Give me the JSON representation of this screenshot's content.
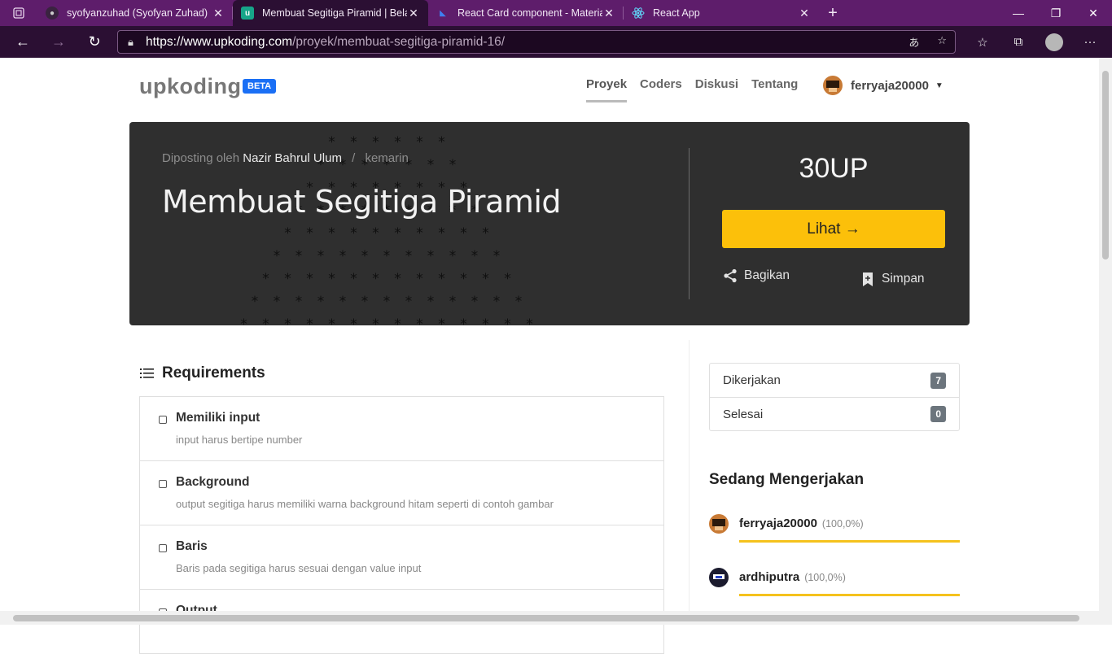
{
  "browser": {
    "tabs": [
      {
        "title": "syofyanzuhad (Syofyan Zuhad)",
        "favicon": "github-icon",
        "active": false
      },
      {
        "title": "Membuat Segitiga Piramid | Belajar",
        "favicon": "upkoding-icon",
        "active": true
      },
      {
        "title": "React Card component - Material",
        "favicon": "mui-icon",
        "active": false
      },
      {
        "title": "React App",
        "favicon": "react-icon",
        "active": false
      }
    ],
    "url_host": "https://www.upkoding.com",
    "url_path": "/proyek/membuat-segitiga-piramid-16/"
  },
  "site": {
    "logo": "upkoding",
    "beta": "BETA",
    "nav": [
      "Proyek",
      "Coders",
      "Diskusi",
      "Tentang"
    ],
    "username": "ferryaja20000"
  },
  "hero": {
    "posted_prefix": "Diposting oleh",
    "author": "Nazir Bahrul Ulum",
    "separator": "/",
    "time": "kemarin",
    "title": "Membuat Segitiga Piramid",
    "points": "30UP",
    "view_button": "Lihat →",
    "share": "Bagikan",
    "save": "Simpan",
    "background_colors": {
      "hero": "#2f2f2f",
      "button": "#fcc00a"
    }
  },
  "requirements": {
    "title": "Requirements",
    "items": [
      {
        "name": "Memiliki input",
        "desc": "input harus bertipe number"
      },
      {
        "name": "Background",
        "desc": "output segitiga harus memiliki warna background hitam seperti di contoh gambar"
      },
      {
        "name": "Baris",
        "desc": "Baris pada segitiga harus sesuai dengan value input"
      },
      {
        "name": "Output",
        "desc": ""
      }
    ]
  },
  "stats": [
    {
      "label": "Dikerjakan",
      "count": "7"
    },
    {
      "label": "Selesai",
      "count": "0"
    }
  ],
  "working": {
    "title": "Sedang Mengerjakan",
    "users": [
      {
        "name": "ferryaja20000",
        "progress": "(100,0%)",
        "progress_value": 1.0
      },
      {
        "name": "ardhiputra",
        "progress": "(100,0%)",
        "progress_value": 1.0
      }
    ]
  }
}
